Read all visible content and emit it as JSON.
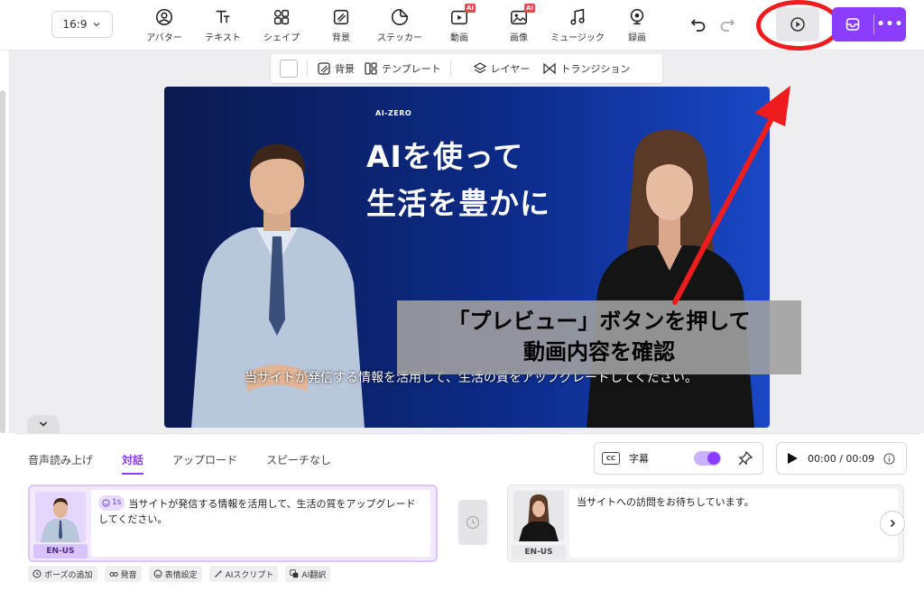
{
  "toolbar": {
    "aspect_ratio": "16:9",
    "tools": [
      {
        "label": "アバター",
        "icon": "avatar-icon"
      },
      {
        "label": "テキスト",
        "icon": "text-icon"
      },
      {
        "label": "シェイプ",
        "icon": "shape-icon"
      },
      {
        "label": "背景",
        "icon": "background-icon"
      },
      {
        "label": "ステッカー",
        "icon": "sticker-icon"
      },
      {
        "label": "動画",
        "icon": "video-icon",
        "badge": "AI"
      },
      {
        "label": "画像",
        "icon": "image-icon",
        "badge": "AI"
      },
      {
        "label": "ミュージック",
        "icon": "music-icon"
      },
      {
        "label": "録画",
        "icon": "record-icon"
      }
    ],
    "more_label": "•••"
  },
  "subbar": {
    "background": "背景",
    "template": "テンプレート",
    "layer": "レイヤー",
    "transition": "トランジション"
  },
  "stage": {
    "brand": "AI-ZERO",
    "headline_line1": "AIを使って",
    "headline_line2": "生活を豊かに",
    "subtitle": "当サイトが発信する情報を活用して、生活の質をアップグレードしてください。"
  },
  "callout": {
    "line1": "「プレビュー」ボタンを押して",
    "line2": "動画内容を確認"
  },
  "panel": {
    "tabs": [
      "音声読み上げ",
      "対話",
      "アップロード",
      "スピーチなし"
    ],
    "active_tab": 1,
    "caption_label": "字幕",
    "time": "00:00 / 00:09",
    "scenes": [
      {
        "lang": "EN-US",
        "pause": "1s",
        "text": "当サイトが発信する情報を活用して、生活の質をアップグレードしてください。"
      },
      {
        "lang": "EN-US",
        "text": "当サイトへの訪問をお待ちしています。"
      }
    ],
    "actions": [
      "ポーズの追加",
      "発音",
      "表情設定",
      "AIスクリプト",
      "AI翻訳"
    ]
  },
  "colors": {
    "accent": "#8b3dff",
    "annotation_red": "#ee1c1c",
    "stage_dark": "#0b1a4f",
    "stage_light": "#1a47c6"
  }
}
